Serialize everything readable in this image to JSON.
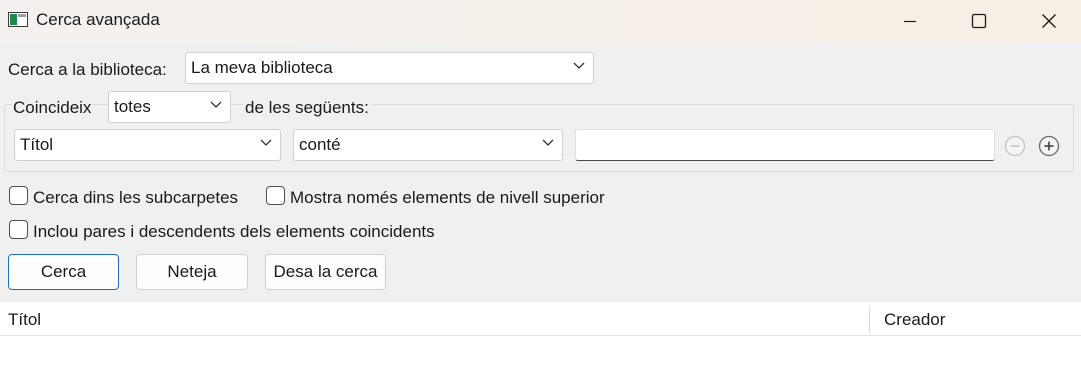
{
  "window": {
    "title": "Cerca avançada"
  },
  "search_in": {
    "label": "Cerca a la biblioteca:",
    "selected": "La meva biblioteca"
  },
  "match": {
    "prefix": "Coincideix",
    "selected": "totes",
    "suffix": "de les següents:"
  },
  "condition": {
    "field": "Títol",
    "operator": "conté",
    "value": ""
  },
  "options": {
    "subfolders": "Cerca dins les subcarpetes",
    "top_level_only": "Mostra només elements de nivell superior",
    "include_parents": "Inclou pares i descendents dels elements coincidents"
  },
  "buttons": {
    "search": "Cerca",
    "clear": "Neteja",
    "save": "Desa la cerca"
  },
  "results": {
    "columns": [
      "Títol",
      "Creador"
    ]
  },
  "colors": {
    "accent": "#1f6fb8",
    "background": "#f0f0f0"
  }
}
